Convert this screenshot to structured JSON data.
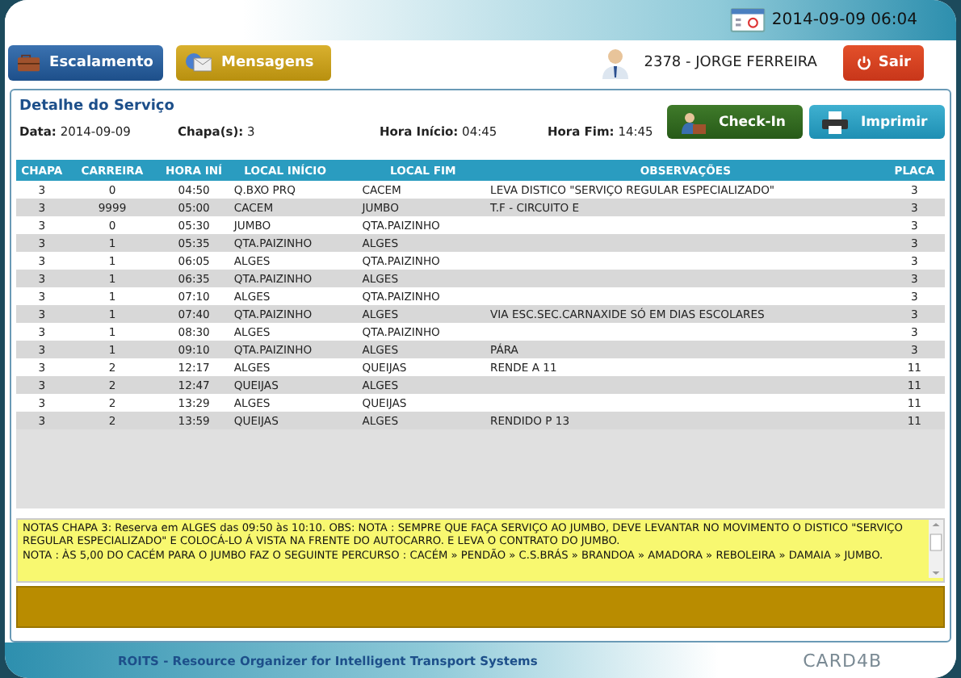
{
  "header": {
    "datetime": "2014-09-09 06:04"
  },
  "nav": [
    {
      "label": "Escalamento",
      "kind": "schedule"
    },
    {
      "label": "Mensagens",
      "kind": "messages"
    }
  ],
  "user": {
    "name": "2378 - JORGE FERREIRA"
  },
  "logout": {
    "label": "Sair"
  },
  "panel": {
    "title": "Detalhe do Serviço",
    "fields": [
      {
        "label": "Data:",
        "value": "2014-09-09"
      },
      {
        "label": "Chapa(s):",
        "value": "3"
      },
      {
        "label": "Hora Início:",
        "value": "04:45"
      },
      {
        "label": "Hora Fim:",
        "value": "14:45"
      }
    ],
    "actions": [
      {
        "label": "Check-In",
        "kind": "checkin"
      },
      {
        "label": "Imprimir",
        "kind": "print"
      }
    ]
  },
  "table": {
    "columns": [
      "CHAPA",
      "CARREIRA",
      "HORA INÍ",
      "LOCAL INÍCIO",
      "LOCAL FIM",
      "OBSERVAÇÕES",
      "PLACA"
    ],
    "rows": [
      [
        "3",
        "0",
        "04:50",
        "Q.BXO PRQ",
        "CACEM",
        "LEVA DISTICO \"SERVIÇO REGULAR ESPECIALIZADO\"",
        "3"
      ],
      [
        "3",
        "9999",
        "05:00",
        "CACEM",
        "JUMBO",
        "T.F - CIRCUITO E",
        "3"
      ],
      [
        "3",
        "0",
        "05:30",
        "JUMBO",
        "QTA.PAIZINHO",
        "",
        "3"
      ],
      [
        "3",
        "1",
        "05:35",
        "QTA.PAIZINHO",
        "ALGES",
        "",
        "3"
      ],
      [
        "3",
        "1",
        "06:05",
        "ALGES",
        "QTA.PAIZINHO",
        "",
        "3"
      ],
      [
        "3",
        "1",
        "06:35",
        "QTA.PAIZINHO",
        "ALGES",
        "",
        "3"
      ],
      [
        "3",
        "1",
        "07:10",
        "ALGES",
        "QTA.PAIZINHO",
        "",
        "3"
      ],
      [
        "3",
        "1",
        "07:40",
        "QTA.PAIZINHO",
        "ALGES",
        "VIA ESC.SEC.CARNAXIDE SÓ EM DIAS ESCOLARES",
        "3"
      ],
      [
        "3",
        "1",
        "08:30",
        "ALGES",
        "QTA.PAIZINHO",
        "",
        "3"
      ],
      [
        "3",
        "1",
        "09:10",
        "QTA.PAIZINHO",
        "ALGES",
        "PÁRA",
        "3"
      ],
      [
        "3",
        "2",
        "12:17",
        "ALGES",
        "QUEIJAS",
        "RENDE A 11",
        "11"
      ],
      [
        "3",
        "2",
        "12:47",
        "QUEIJAS",
        "ALGES",
        "",
        "11"
      ],
      [
        "3",
        "2",
        "13:29",
        "ALGES",
        "QUEIJAS",
        "",
        "11"
      ],
      [
        "3",
        "2",
        "13:59",
        "QUEIJAS",
        "ALGES",
        "RENDIDO P 13",
        "11"
      ]
    ]
  },
  "notes": [
    "NOTAS CHAPA 3: Reserva em ALGES das 09:50 às 10:10. OBS: NOTA : SEMPRE QUE FAÇA SERVIÇO AO JUMBO, DEVE LEVANTAR NO MOVIMENTO O DISTICO \"SERVIÇO REGULAR ESPECIALIZADO\" E COLOCÁ-LO Á VISTA NA FRENTE DO AUTOCARRO. E LEVA O CONTRATO DO JUMBO.",
    "NOTA : ÀS 5,00 DO CACÉM PARA O JUMBO FAZ O SEGUINTE PERCURSO : CACÉM » PENDÃO » C.S.BRÁS » BRANDOA » AMADORA » REBOLEIRA » DAMAIA » JUMBO."
  ],
  "footer": {
    "text": "ROITS - Resource Organizer for Intelligent Transport Systems",
    "logo": "CARD4B"
  }
}
